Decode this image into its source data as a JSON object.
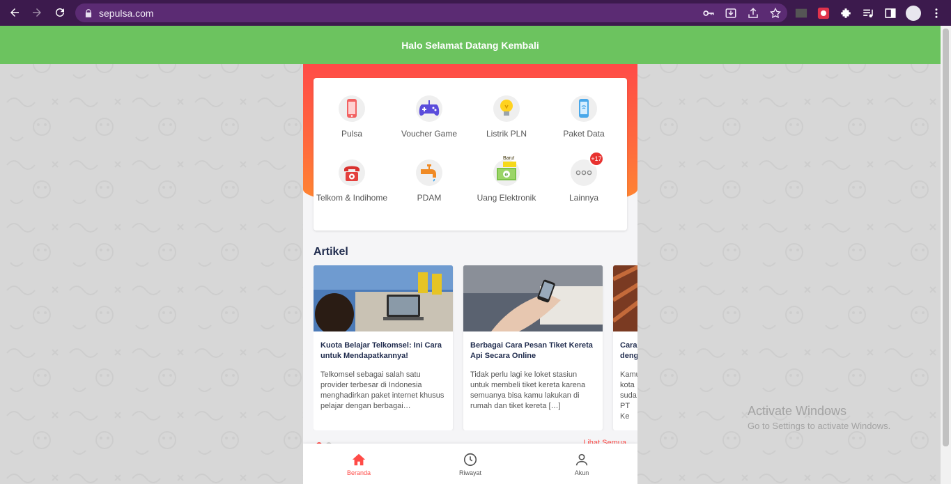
{
  "browser": {
    "url": "sepulsa.com"
  },
  "page": {
    "welcome_text": "Halo Selamat Datang Kembali",
    "menu": [
      {
        "label": "Pulsa",
        "icon": "phone-icon"
      },
      {
        "label": "Voucher Game",
        "icon": "gamepad-icon"
      },
      {
        "label": "Listrik PLN",
        "icon": "lightbulb-icon"
      },
      {
        "label": "Paket Data",
        "icon": "data-phone-icon"
      },
      {
        "label": "Telkom & Indihome",
        "icon": "telephone-icon"
      },
      {
        "label": "PDAM",
        "icon": "water-tap-icon"
      },
      {
        "label": "Uang Elektronik",
        "icon": "e-money-icon",
        "tag": "Baru!"
      },
      {
        "label": "Lainnya",
        "icon": "more-icon",
        "badge": "+17"
      }
    ],
    "articles_title": "Artikel",
    "articles": [
      {
        "title": "Kuota Belajar Telkomsel: Ini Cara untuk Mendapatkannya!",
        "desc": "Telkomsel sebagai salah satu provider terbesar di Indonesia menghadirkan paket internet khusus pelajar dengan berbagai…"
      },
      {
        "title": "Berbagai Cara Pesan Tiket Kereta Api Secara Online",
        "desc": "Tidak perlu lagi ke loket stasiun untuk membeli tiket kereta karena semuanya bisa kamu lakukan di rumah dan tiket kereta […]"
      },
      {
        "title": "Cara dengan",
        "desc": "Kamu kota suda PT Ke"
      }
    ],
    "see_all": "Lihat Semua",
    "bottom_nav": [
      {
        "label": "Beranda",
        "icon": "home-icon"
      },
      {
        "label": "Riwayat",
        "icon": "clock-icon"
      },
      {
        "label": "Akun",
        "icon": "user-icon"
      }
    ],
    "colors": {
      "brand": "#ff4b47",
      "welcome_bar": "#6cc35f",
      "browser_frame": "#3c1a4d"
    }
  },
  "os": {
    "watermark_title": "Activate Windows",
    "watermark_sub": "Go to Settings to activate Windows."
  }
}
